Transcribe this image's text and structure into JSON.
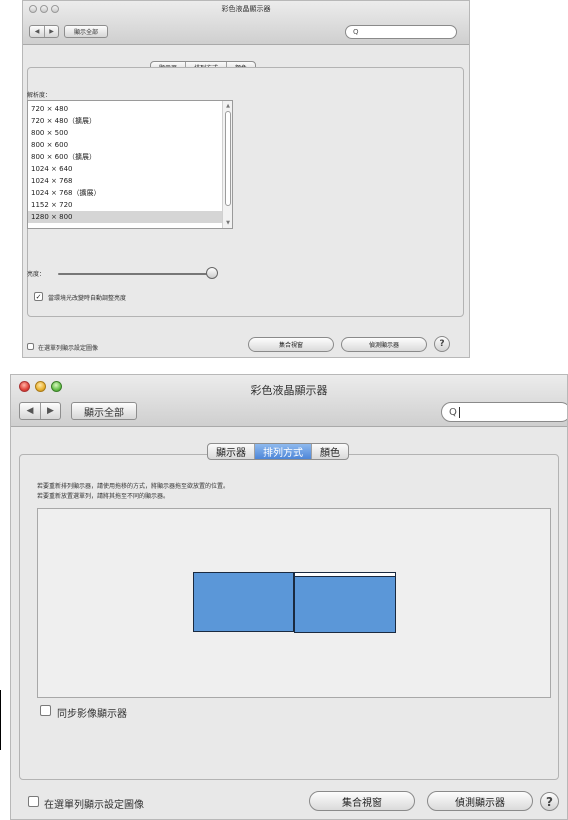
{
  "window1": {
    "title": "彩色液晶顯示器",
    "show_all": "顯示全部",
    "search_icon": "Q",
    "tabs": [
      {
        "label": "顯示器",
        "active": true
      },
      {
        "label": "排列方式",
        "active": false
      },
      {
        "label": "顏色",
        "active": false
      }
    ],
    "resolution_label": "解析度：",
    "resolutions": [
      "720 × 480",
      "720 × 480（擴展）",
      "800 × 500",
      "800 × 600",
      "800 × 600（擴展）",
      "1024 × 640",
      "1024 × 768",
      "1024 × 768（擴展）",
      "1152 × 720",
      "1280 × 800"
    ],
    "selected_resolution": "1280 × 800",
    "brightness_label": "亮度：",
    "brightness_level": 1.0,
    "auto_brightness_label": "當環境光改變時自動調整亮度",
    "auto_brightness_checked": true,
    "show_in_menubar_label": "在選單列顯示設定圖像",
    "show_in_menubar_checked": false,
    "gather_windows_button": "集合視窗",
    "detect_displays_button": "偵測顯示器",
    "help": "?"
  },
  "window2": {
    "title": "彩色液晶顯示器",
    "show_all": "顯示全部",
    "search_icon": "Q",
    "tabs": [
      {
        "label": "顯示器",
        "active": false
      },
      {
        "label": "排列方式",
        "active": true
      },
      {
        "label": "顏色",
        "active": false
      }
    ],
    "instructions_line1": "若要重新排列顯示器，請使用拖移的方式，將顯示器拖至欲放置的位置。",
    "instructions_line2": "若要重新放置選單列，請將其拖至不同的顯示器。",
    "mirror_label": "同步影像顯示器",
    "mirror_checked": false,
    "show_in_menubar_label": "在選單列顯示設定圖像",
    "show_in_menubar_checked": false,
    "gather_windows_button": "集合視窗",
    "detect_displays_button": "偵測顯示器",
    "help": "?"
  },
  "icons": {
    "back": "◀",
    "forward": "▶",
    "checkmark": "✓",
    "scroll_up": "▲",
    "scroll_down": "▼"
  },
  "colors": {
    "display_fill": "#5b97d8",
    "selected_tab": "#4e86d8"
  }
}
